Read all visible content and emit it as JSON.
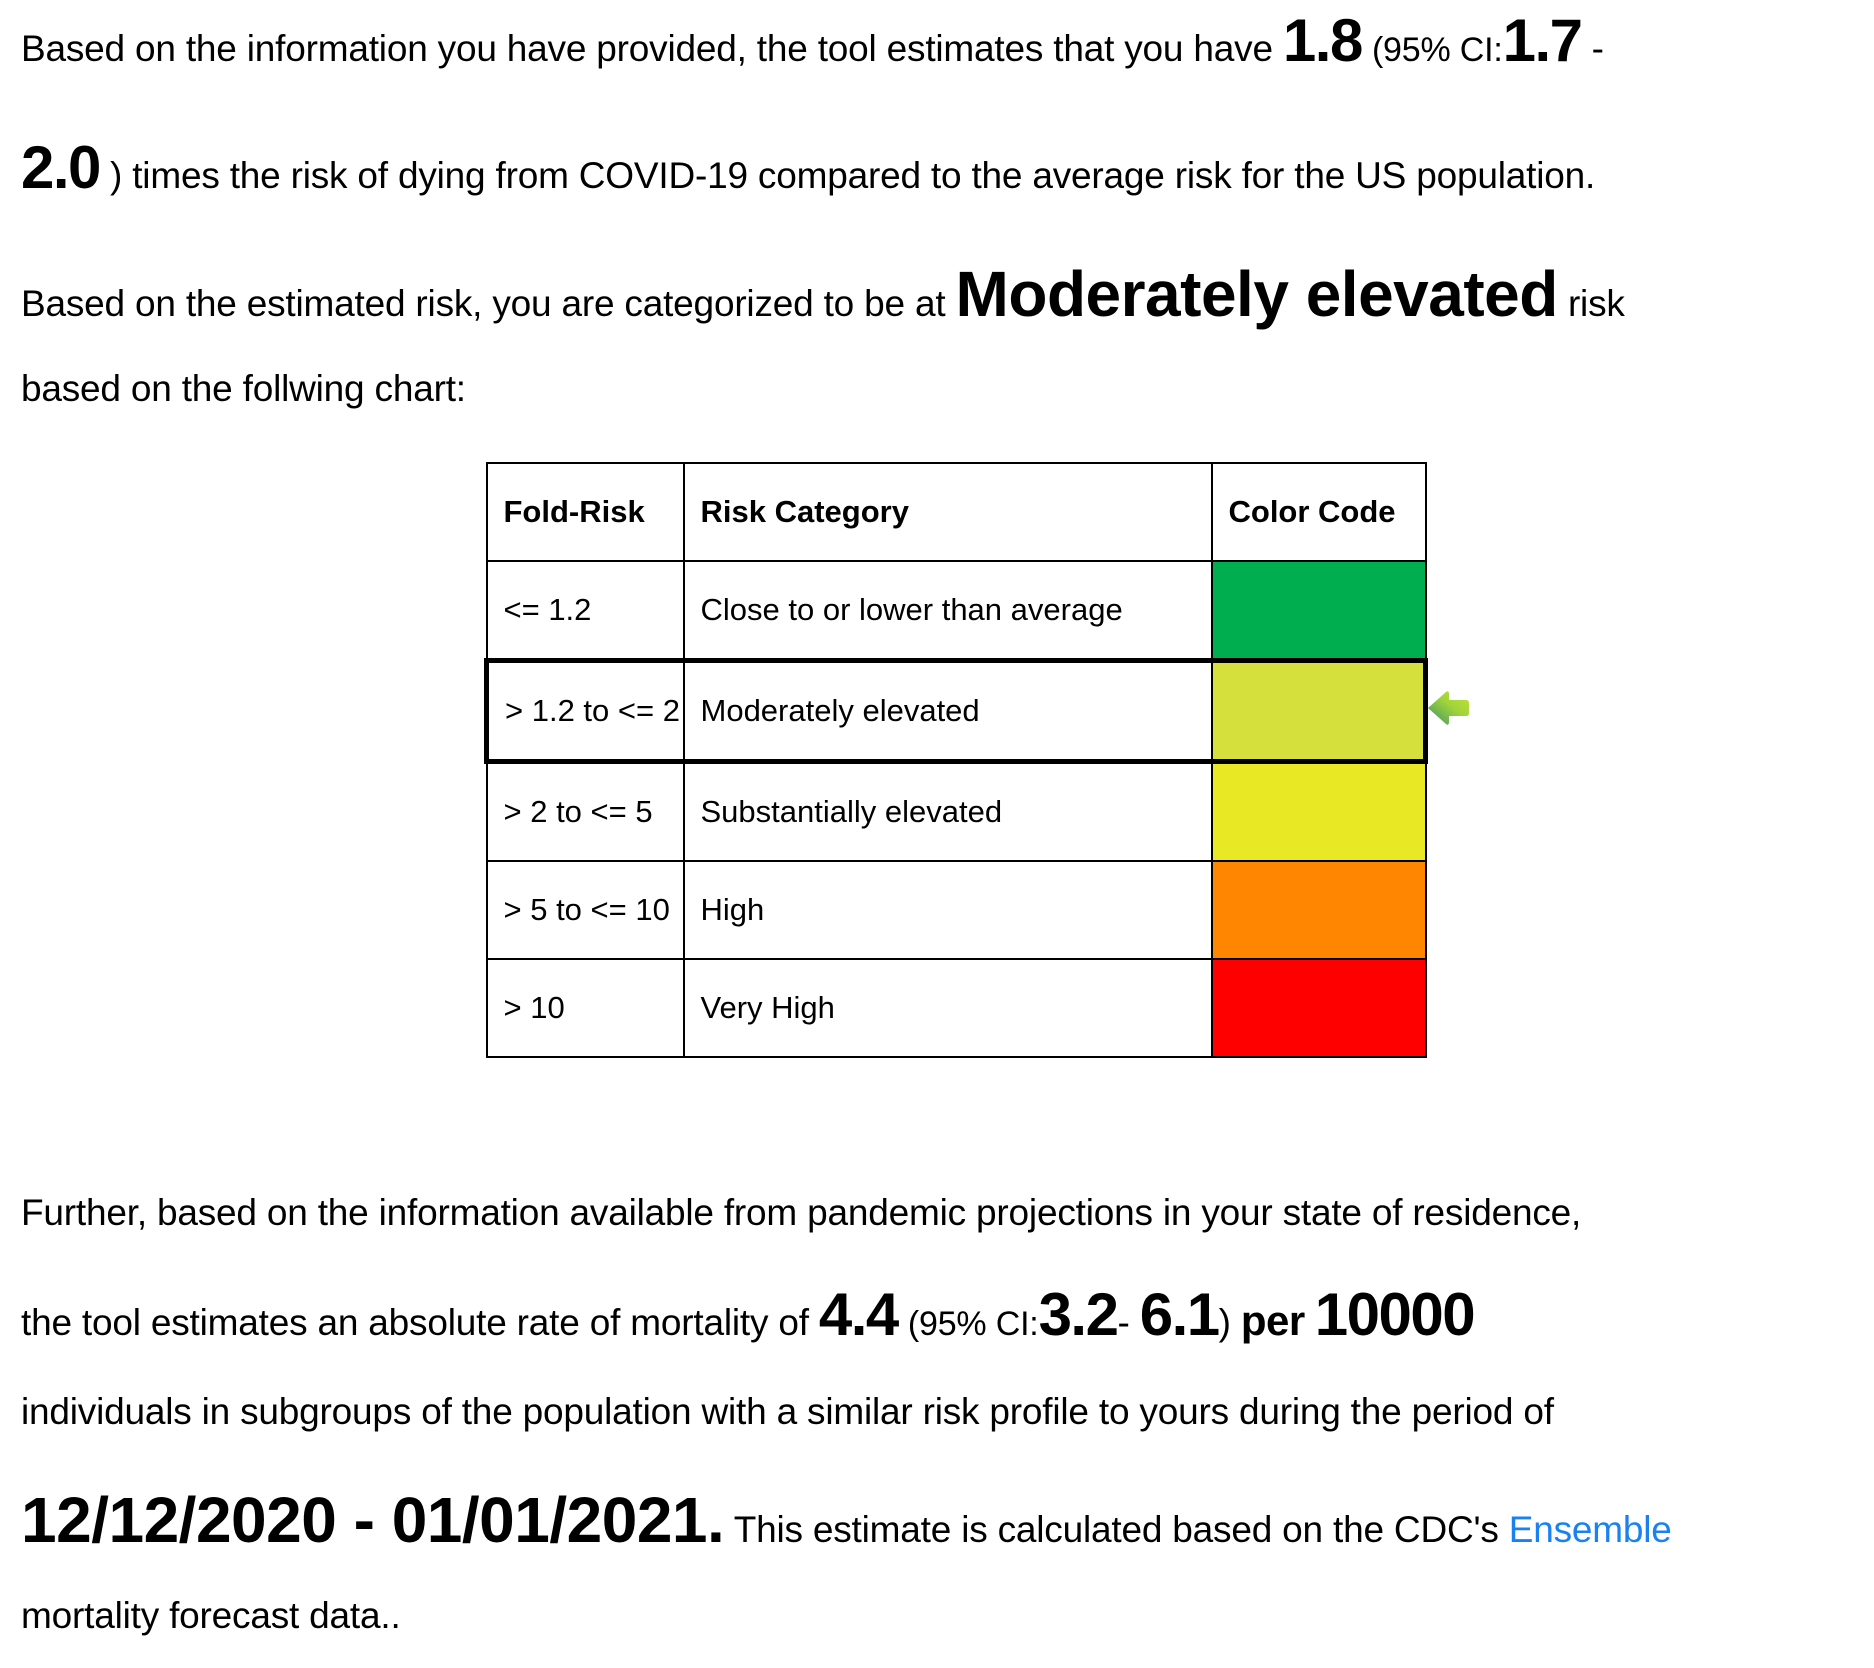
{
  "paragraph1": {
    "line1_prefix": "Based on the information you have provided, the tool estimates that you have",
    "fold_risk": "1.8",
    "ci_open": "(95% CI:",
    "ci_low": "1.7",
    "ci_dash": "-",
    "ci_high": "2.0",
    "line2_suffix": ") times the risk of dying from COVID-19 compared to the average risk for the US population."
  },
  "paragraph2": {
    "prefix": "Based on the estimated risk, you are categorized to be at",
    "category": "Moderately elevated",
    "suffix": "risk",
    "line2": "based on the follwing chart:"
  },
  "risk_table": {
    "headers": [
      "Fold-Risk",
      "Risk Category",
      "Color Code"
    ],
    "rows": [
      {
        "fold_risk": "<= 1.2",
        "category": "Close to or lower than average",
        "color": "#00ad4f"
      },
      {
        "fold_risk": "> 1.2 to <= 2",
        "category": "Moderately elevated",
        "color": "#d5e03d"
      },
      {
        "fold_risk": "> 2 to <= 5",
        "category": "Substantially elevated",
        "color": "#e8e825"
      },
      {
        "fold_risk": "> 5 to <= 10",
        "category": "High",
        "color": "#ff8600"
      },
      {
        "fold_risk": "> 10",
        "category": "Very High",
        "color": "#ff0000"
      }
    ],
    "highlighted_row": 1,
    "indicator_icon": "left-arrow-icon"
  },
  "paragraph3": {
    "line1": "Further, based on the information available from pandemic projections in your state of residence,",
    "line2_prefix": "the tool estimates an absolute rate of mortality of",
    "rate": "4.4",
    "ci_open": "(95% CI:",
    "ci_low": "3.2",
    "ci_dash": "-",
    "ci_high": "6.1",
    "ci_close": ")",
    "per_label": "per",
    "per_value": "10000",
    "line3": "individuals in subgroups of the population with a similar risk profile to yours during the period of",
    "period": "12/12/2020 - 01/01/2021.",
    "line4_suffix": "This estimate is calculated based on the CDC's",
    "link_text": "Ensemble",
    "line5": "mortality forecast data.."
  }
}
